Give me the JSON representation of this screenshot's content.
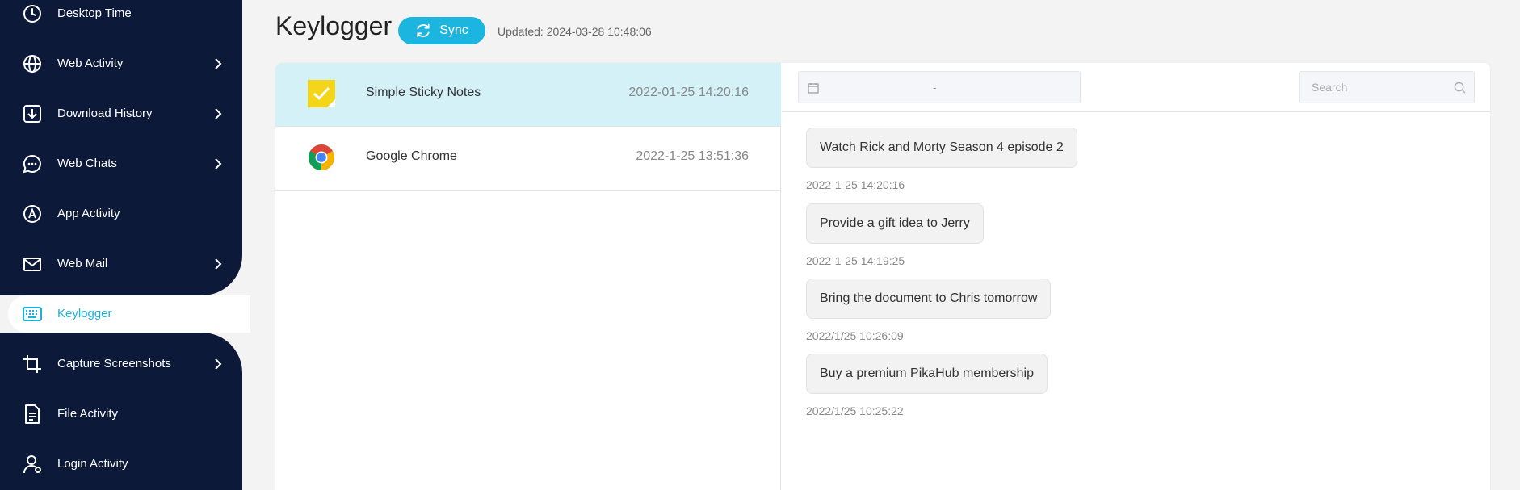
{
  "sidebar": {
    "items": [
      {
        "label": "Desktop Time",
        "icon": "clock-icon",
        "has_chevron": false
      },
      {
        "label": "Web Activity",
        "icon": "globe-icon",
        "has_chevron": true
      },
      {
        "label": "Download History",
        "icon": "download-icon",
        "has_chevron": true
      },
      {
        "label": "Web Chats",
        "icon": "chat-bubble-icon",
        "has_chevron": true
      },
      {
        "label": "App Activity",
        "icon": "app-store-icon",
        "has_chevron": false
      },
      {
        "label": "Web Mail",
        "icon": "mail-icon",
        "has_chevron": true
      },
      {
        "label": "Keylogger",
        "icon": "keyboard-icon",
        "has_chevron": false,
        "active": true
      },
      {
        "label": "Capture Screenshots",
        "icon": "crop-icon",
        "has_chevron": true
      },
      {
        "label": "File Activity",
        "icon": "file-icon",
        "has_chevron": false
      },
      {
        "label": "Login Activity",
        "icon": "user-icon",
        "has_chevron": false
      }
    ]
  },
  "header": {
    "title": "Keylogger",
    "sync_label": "Sync",
    "updated": "Updated: 2024-03-28 10:48:06"
  },
  "apps": [
    {
      "name": "Simple Sticky Notes",
      "time": "2022-01-25 14:20:16",
      "icon": "sticky-notes-icon",
      "selected": true
    },
    {
      "name": "Google Chrome",
      "time": "2022-1-25 13:51:36",
      "icon": "chrome-icon",
      "selected": false
    }
  ],
  "filter": {
    "date_separator": "-",
    "search_placeholder": "Search"
  },
  "messages": [
    {
      "text": "Watch Rick and Morty Season 4 episode 2",
      "time": "2022-1-25 14:20:16"
    },
    {
      "text": "Provide a gift idea to Jerry",
      "time": "2022-1-25 14:19:25"
    },
    {
      "text": "Bring the document to Chris tomorrow",
      "time": "2022/1/25 10:26:09"
    },
    {
      "text": "Buy a premium PikaHub membership",
      "time": "2022/1/25 10:25:22"
    }
  ],
  "colors": {
    "sidebar_bg": "#0d1938",
    "accent": "#1cb5e0",
    "selected_row": "#d4f1f7"
  }
}
